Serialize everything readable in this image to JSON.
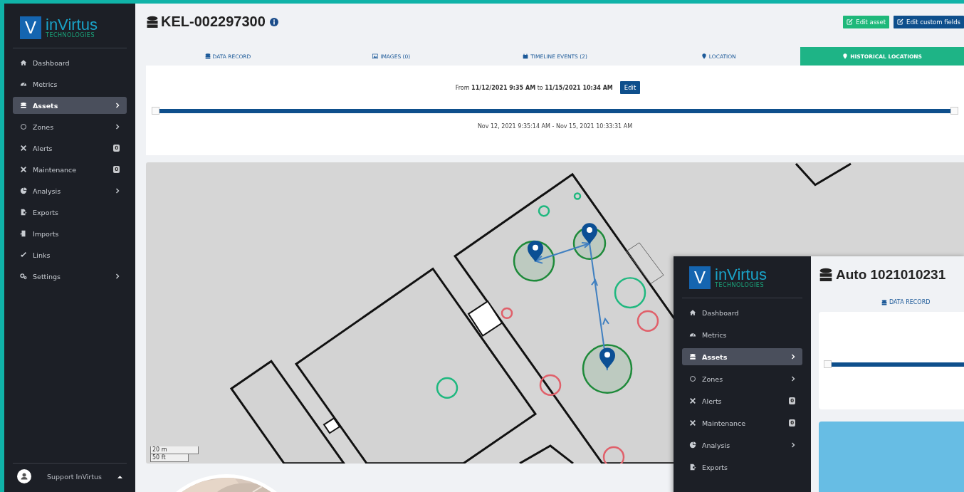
{
  "sidebar": {
    "logo": {
      "mark": "V",
      "name": "inVirtus",
      "tagline": "TECHNOLOGIES"
    },
    "items": [
      {
        "label": "Dashboard",
        "selected": false,
        "expandable": false
      },
      {
        "label": "Metrics",
        "selected": false,
        "expandable": false
      },
      {
        "label": "Assets",
        "selected": true,
        "expandable": true
      },
      {
        "label": "Zones",
        "selected": false,
        "expandable": true
      },
      {
        "label": "Alerts",
        "selected": false,
        "expandable": false,
        "badge": "0"
      },
      {
        "label": "Maintenance",
        "selected": false,
        "expandable": false,
        "badge": "0"
      },
      {
        "label": "Analysis",
        "selected": false,
        "expandable": true
      },
      {
        "label": "Exports",
        "selected": false,
        "expandable": false
      },
      {
        "label": "Imports",
        "selected": false,
        "expandable": false
      },
      {
        "label": "Links",
        "selected": false,
        "expandable": false
      },
      {
        "label": "Settings",
        "selected": false,
        "expandable": true
      }
    ],
    "user": {
      "name": "Support InVirtus"
    }
  },
  "asset": {
    "title": "KEL-002297300"
  },
  "buttons": [
    {
      "label": "Edit asset",
      "kind": "success"
    },
    {
      "label": "Edit custom fields",
      "kind": "primary"
    }
  ],
  "tabs": [
    {
      "label": "DATA RECORD",
      "selected": false
    },
    {
      "label": "IMAGES (0)",
      "selected": false
    },
    {
      "label": "TIMELINE EVENTS (2)",
      "selected": false
    },
    {
      "label": "LOCATION",
      "selected": false
    },
    {
      "label": "HISTORICAL LOCATIONS",
      "selected": true
    }
  ],
  "range": {
    "text": "From **11/12/2021 9:35 AM** to **11/15/2021 10:34 AM**",
    "edit_button": "Edit",
    "level": 1,
    "reading": "Nov 12, 2021 9:35:14 AM - Nov 15, 2021 10:33:31 AM"
  },
  "map": {
    "scale": [
      "20 m",
      "50 ft"
    ]
  },
  "inset": {
    "logo": {
      "mark": "V",
      "name": "inVirtus",
      "tagline": "TECHNOLOGIES"
    },
    "items": [
      {
        "label": "Dashboard",
        "selected": false,
        "expandable": false
      },
      {
        "label": "Metrics",
        "selected": false,
        "expandable": false
      },
      {
        "label": "Assets",
        "selected": true,
        "expandable": true
      },
      {
        "label": "Zones",
        "selected": false,
        "expandable": true
      },
      {
        "label": "Alerts",
        "selected": false,
        "expandable": false,
        "badge": "0"
      },
      {
        "label": "Maintenance",
        "selected": false,
        "expandable": false,
        "badge": "0"
      },
      {
        "label": "Analysis",
        "selected": false,
        "expandable": true
      },
      {
        "label": "Exports",
        "selected": false,
        "expandable": false
      }
    ],
    "title": "Auto 1021010231",
    "tab": "DATA RECORD",
    "level": 1
  }
}
